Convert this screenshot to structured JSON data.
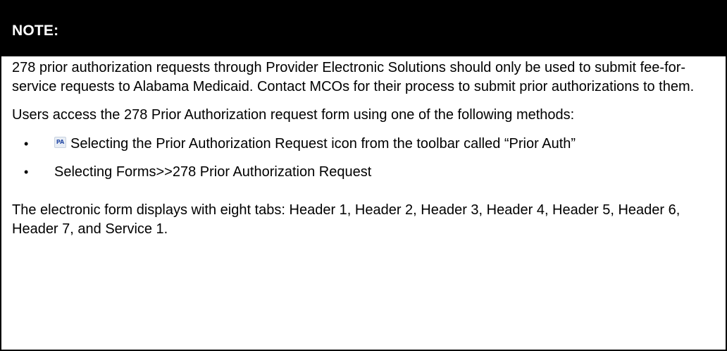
{
  "note": {
    "header": "NOTE:",
    "paragraph1": "278 prior authorization requests through Provider Electronic Solutions should only be used to submit fee-for-service requests to Alabama Medicaid. Contact MCOs for their process to submit prior authorizations to them.",
    "paragraph2": "Users access the 278 Prior Authorization request form using one of the following methods:",
    "bullets": [
      {
        "icon": "prior-auth-icon",
        "icon_text": "PA",
        "text": "Selecting the Prior Authorization Request icon from the toolbar called “Prior Auth”"
      },
      {
        "text": "Selecting Forms>>278 Prior Authorization Request"
      }
    ],
    "bullet_symbol": "•",
    "paragraph3": "The electronic form displays with eight tabs: Header 1, Header 2, Header 3, Header 4, Header 5, Header 6, Header 7, and Service 1."
  },
  "colors": {
    "header_background": "#000000",
    "header_text": "#ffffff",
    "border": "#000000"
  }
}
